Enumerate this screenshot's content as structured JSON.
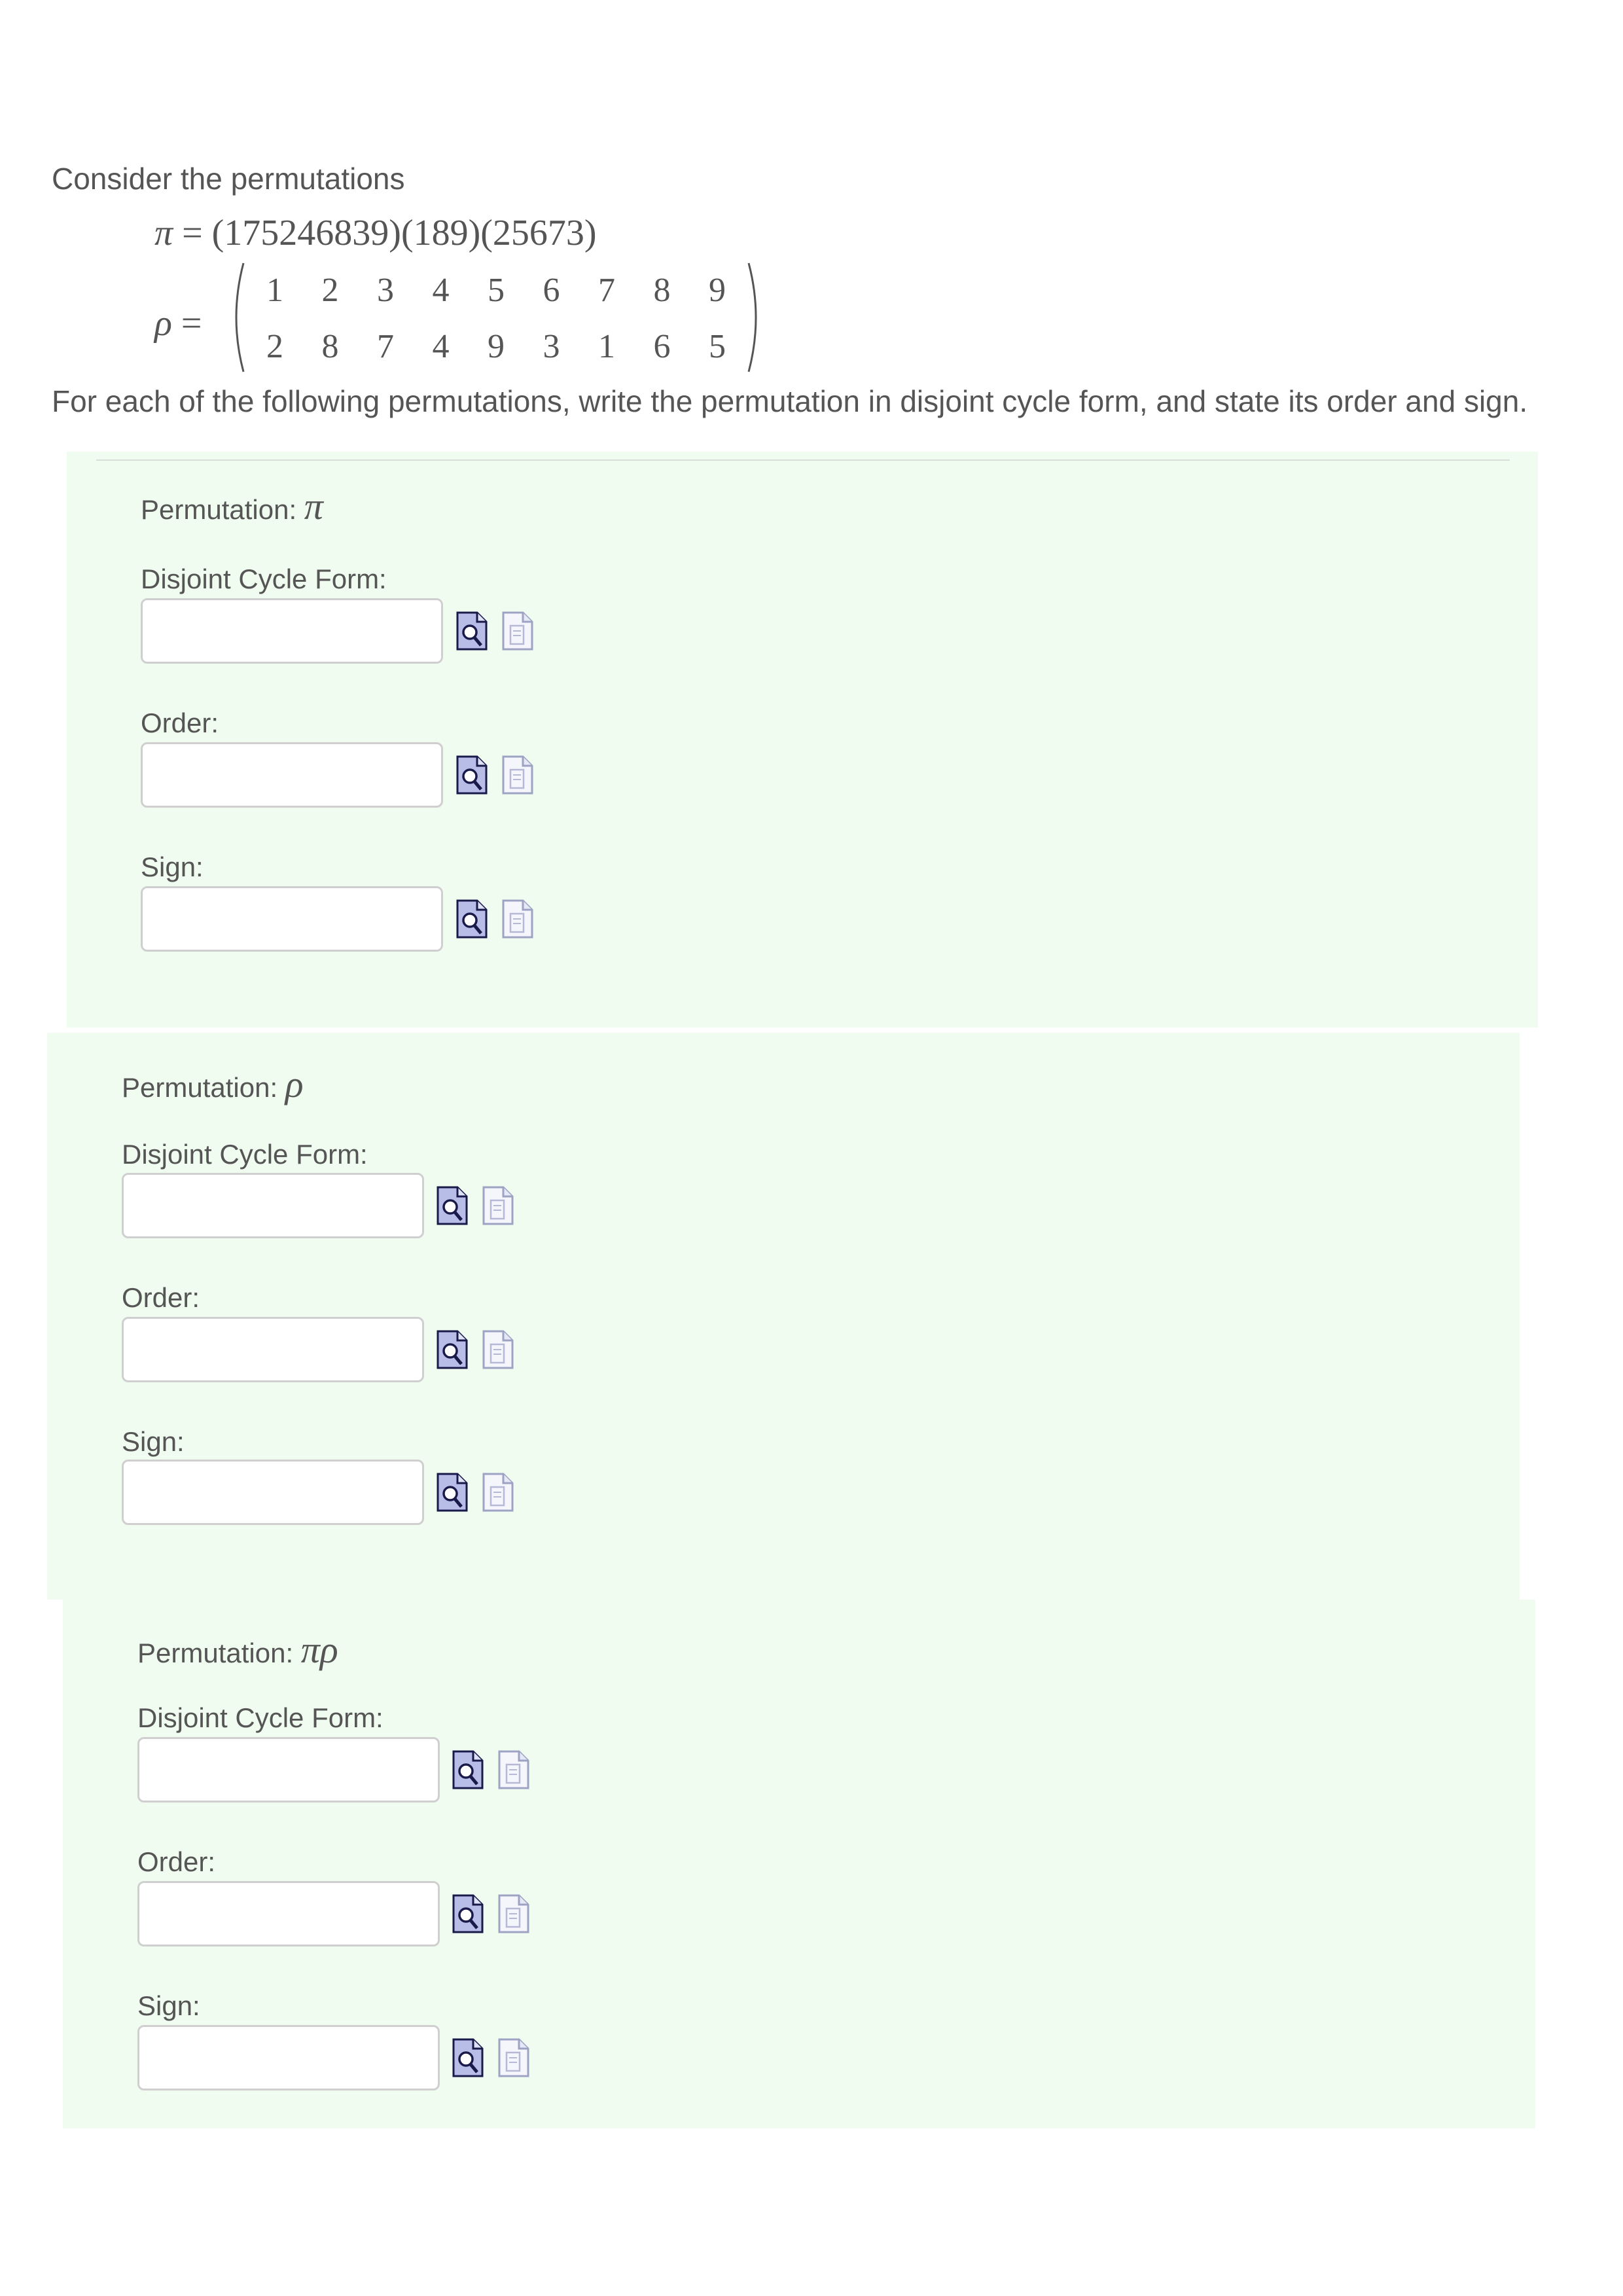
{
  "intro_text": "Consider the permutations",
  "pi_definition": {
    "symbol": "π",
    "equals": " = ",
    "cycles": "(175246839)(189)(25673)"
  },
  "rho_definition": {
    "symbol": "ρ",
    "equals": " =",
    "top_row": [
      "1",
      "2",
      "3",
      "4",
      "5",
      "6",
      "7",
      "8",
      "9"
    ],
    "bottom_row": [
      "2",
      "8",
      "7",
      "4",
      "9",
      "3",
      "1",
      "6",
      "5"
    ]
  },
  "instructions": "For each of the following permutations, write the permutation in disjoint cycle form, and state its order and sign.",
  "parts": [
    {
      "title_prefix": "Permutation: ",
      "variable": "π",
      "fields": [
        {
          "label": "Disjoint Cycle Form:",
          "value": ""
        },
        {
          "label": "Order:",
          "value": ""
        },
        {
          "label": "Sign:",
          "value": ""
        }
      ]
    },
    {
      "title_prefix": "Permutation: ",
      "variable": "ρ",
      "fields": [
        {
          "label": "Disjoint Cycle Form:",
          "value": ""
        },
        {
          "label": "Order:",
          "value": ""
        },
        {
          "label": "Sign:",
          "value": ""
        }
      ]
    },
    {
      "title_prefix": "Permutation: ",
      "variable": "πρ",
      "fields": [
        {
          "label": "Disjoint Cycle Form:",
          "value": ""
        },
        {
          "label": "Order:",
          "value": ""
        },
        {
          "label": "Sign:",
          "value": ""
        }
      ]
    }
  ],
  "icons": {
    "preview": "preview-magnifier-icon",
    "format_help": "format-help-document-icon"
  },
  "colors": {
    "part_background": "#effcef",
    "input_border": "#cfcfcf",
    "text": "#555555"
  }
}
